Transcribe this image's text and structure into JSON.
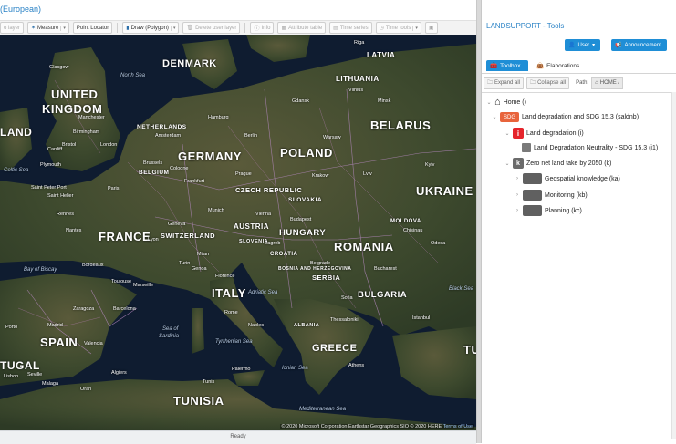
{
  "map_title": "(European)",
  "toolbar": {
    "add_layer_label": "o layer",
    "measure_label": "Measure",
    "point_locator_label": "Point Locator",
    "draw_label": "Draw (Polygon)",
    "delete_user_layer_label": "Delete user layer",
    "info_label": "Info",
    "attribute_table_label": "Attribute table",
    "time_series_label": "Time series",
    "time_tools_label": "Time tools"
  },
  "map": {
    "countries": {
      "denmark": "DENMARK",
      "latvia": "LATVIA",
      "lithuania": "LITHUANIA",
      "united_kingdom_1": "UNITED",
      "united_kingdom_2": "KINGDOM",
      "belarus": "BELARUS",
      "land": "LAND",
      "netherlands": "NETHERLANDS",
      "germany": "GERMANY",
      "poland": "POLAND",
      "belgium": "BELGIUM",
      "czech_republic": "CZECH REPUBLIC",
      "ukraine": "UKRAINE",
      "slovakia": "SLOVAKIA",
      "moldova": "MOLDOVA",
      "france": "FRANCE",
      "austria": "AUSTRIA",
      "switzerland": "SWITZERLAND",
      "hungary": "HUNGARY",
      "romania": "ROMANIA",
      "slovenia": "SLOVENIA",
      "croatia": "CROATIA",
      "bosnia": "BOSNIA AND HERZEGOVINA",
      "serbia": "SERBIA",
      "bulgaria": "BULGARIA",
      "italy": "ITALY",
      "albania": "ALBANIA",
      "spain": "SPAIN",
      "greece": "GREECE",
      "tugal": "TUGAL",
      "tunisia": "TUNISIA",
      "tu": "TU"
    },
    "seas": {
      "north_sea": "North Sea",
      "celtic_sea": "Celtic Sea",
      "bay_of_biscay": "Bay of Biscay",
      "adriatic_sea": "Adriatic Sea",
      "sea_of_sardinia_1": "Sea of",
      "sea_of_sardinia_2": "Sardinia",
      "tyrrhenian_sea": "Tyrrhenian Sea",
      "ionian_sea": "Ionian Sea",
      "black_sea": "Black Sea",
      "mediterranean_sea": "Mediterranean Sea"
    },
    "cities": {
      "glasgow": "Glasgow",
      "manchester": "Manchester",
      "birmingham": "Birmingham",
      "london": "London",
      "cardiff": "Cardiff",
      "bristol": "Bristol",
      "plymouth": "Plymouth",
      "saint_helier": "Saint Helier",
      "saint_peter_port": "Saint Peter Port",
      "rennes": "Rennes",
      "nantes": "Nantes",
      "paris": "Paris",
      "brussels": "Brussels",
      "amsterdam": "Amsterdam",
      "hamburg": "Hamburg",
      "berlin": "Berlin",
      "cologne": "Cologne",
      "frankfurt": "Frankfurt",
      "prague": "Prague",
      "munich": "Munich",
      "vienna": "Vienna",
      "warsaw": "Warsaw",
      "krakow": "Krakow",
      "lviv": "Lviv",
      "kyiv": "Kyiv",
      "minsk": "Minsk",
      "vilnius": "Vilnius",
      "riga": "Riga",
      "gdansk": "Gdansk",
      "bordeaux": "Bordeaux",
      "toulouse": "Toulouse",
      "lyon": "Lyon",
      "geneva": "Geneva",
      "milan": "Milan",
      "turin": "Turin",
      "genoa": "Genoa",
      "marseille": "Marseille",
      "florence": "Florence",
      "rome": "Rome",
      "naples": "Naples",
      "zagreb": "Zagreb",
      "belgrade": "Belgrade",
      "budapest": "Budapest",
      "bucharest": "Bucharest",
      "sofia": "Sofia",
      "istanbul": "Istanbul",
      "athens": "Athens",
      "thessaloniki": "Thessaloniki",
      "odesa": "Odesa",
      "chisinau": "Chisinau",
      "madrid": "Madrid",
      "barcelona": "Barcelona",
      "valencia": "Valencia",
      "lisbon": "Lisbon",
      "seville": "Seville",
      "malaga": "Malaga",
      "algiers": "Algiers",
      "tunis": "Tunis",
      "oran": "Oran",
      "palermo": "Palermo",
      "zaragoza": "Zaragoza",
      "porto": "Porto"
    },
    "attribution": "© 2020 Microsoft Corporation Earthstar Geographics SIO © 2020 HERE",
    "terms_link": "Terms of Use"
  },
  "status_text": "Ready",
  "panel": {
    "title": "LANDSUPPORT - Tools",
    "user_button": "User",
    "announcement_button": "Announcement",
    "tabs": [
      "Toolbox",
      "Elaborations"
    ],
    "expand_all": "Expand all",
    "collapse_all": "Collapse all",
    "path_label": "Path:",
    "path_value": "HOME /"
  },
  "tree": {
    "home": "Home ()",
    "land_degradation_sdg": "Land degradation and SDG 15.3 (saldnb)",
    "sdg_icon_text": "SDG",
    "land_degradation": "Land degradation (i)",
    "ldn": "Land Degradation Neutrality - SDG 15.3 (i1)",
    "zero_net_land_take": "Zero net land take by 2050 (k)",
    "geospatial_knowledge": "Geospatial knowledge (ka)",
    "monitoring": "Monitoring (kb)",
    "planning": "Planning (kc)",
    "i_icon_text": "i",
    "k_icon_text": "k"
  },
  "colors": {
    "accent": "#1f8ed6",
    "title_blue": "#2b83c6",
    "sdg_orange": "#e8643c",
    "indicator_red": "#e5242b"
  }
}
